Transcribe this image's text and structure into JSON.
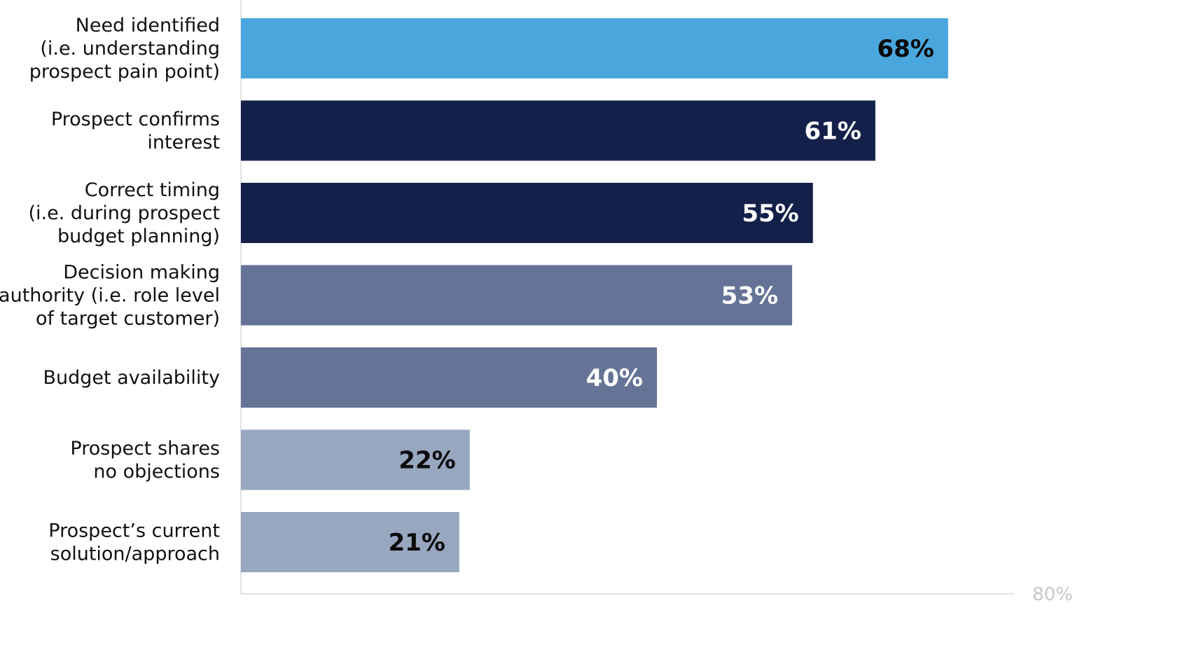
{
  "chart_data": {
    "type": "bar",
    "orientation": "horizontal",
    "title": "",
    "xlabel": "",
    "ylabel": "",
    "xlim": [
      0,
      80
    ],
    "grid": false,
    "legend": "none",
    "x_ticks": [
      "80%"
    ],
    "categories": [
      [
        "Need identified",
        "(i.e. understanding",
        "prospect pain point)"
      ],
      [
        "Prospect confirms",
        "interest"
      ],
      [
        "Correct timing",
        "(i.e. during prospect",
        "budget planning)"
      ],
      [
        "Decision making",
        "authority (i.e. role level",
        "of target customer)"
      ],
      [
        "Budget availability"
      ],
      [
        "Prospect shares",
        "no objections"
      ],
      [
        "Prospect’s current",
        "solution/approach"
      ]
    ],
    "values": [
      68,
      61,
      55,
      53,
      40,
      22,
      21
    ],
    "value_labels": [
      "68%",
      "61%",
      "55%",
      "53%",
      "40%",
      "22%",
      "21%"
    ],
    "bar_colors": [
      "#4aa7dd",
      "#13214a",
      "#13214a",
      "#647396",
      "#647396",
      "#98a7c0",
      "#98a7c0"
    ],
    "label_colors": [
      "#0a0a0a",
      "#ffffff",
      "#ffffff",
      "#ffffff",
      "#ffffff",
      "#0a0a0a",
      "#0a0a0a"
    ],
    "axis_color": "#d9d9d9"
  }
}
